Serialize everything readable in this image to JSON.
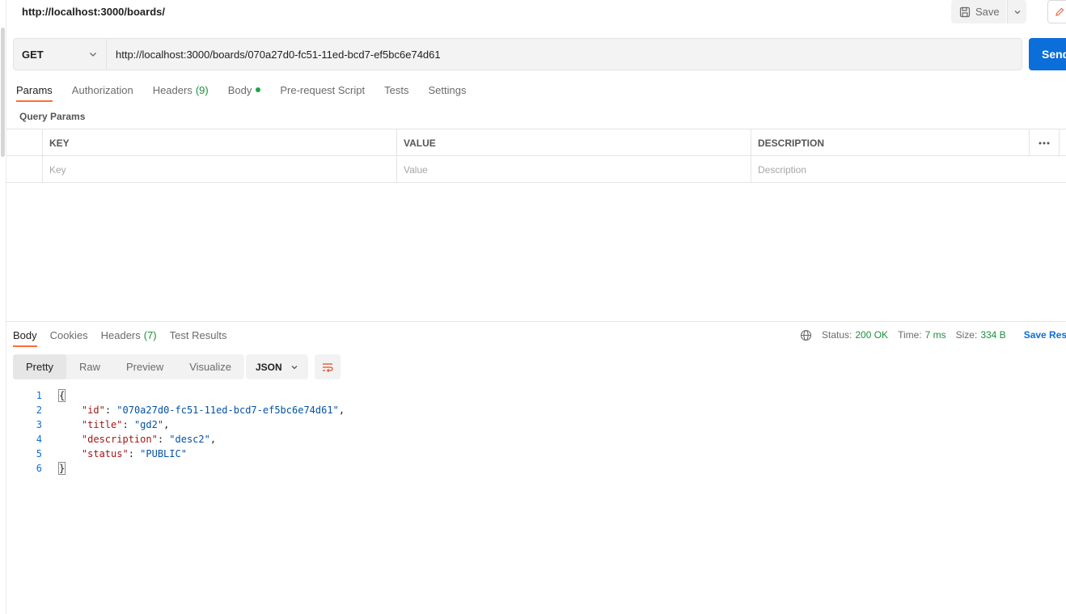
{
  "request": {
    "name": "http://localhost:3000/boards/",
    "save_label": "Save",
    "method": "GET",
    "url": "http://localhost:3000/boards/070a27d0-fc51-11ed-bcd7-ef5bc6e74d61",
    "send_label": "Send"
  },
  "request_tabs": [
    {
      "label": "Params",
      "active": true
    },
    {
      "label": "Authorization"
    },
    {
      "label": "Headers",
      "count": "(9)"
    },
    {
      "label": "Body",
      "dot": true
    },
    {
      "label": "Pre-request Script"
    },
    {
      "label": "Tests"
    },
    {
      "label": "Settings"
    }
  ],
  "query_params": {
    "label": "Query Params",
    "headers": [
      "KEY",
      "VALUE",
      "DESCRIPTION"
    ],
    "placeholders": [
      "Key",
      "Value",
      "Description"
    ]
  },
  "response_tabs": [
    {
      "label": "Body",
      "active": true
    },
    {
      "label": "Cookies"
    },
    {
      "label": "Headers",
      "count": "(7)"
    },
    {
      "label": "Test Results"
    }
  ],
  "response_meta": {
    "status_label": "Status:",
    "status_value": "200 OK",
    "time_label": "Time:",
    "time_value": "7 ms",
    "size_label": "Size:",
    "size_value": "334 B",
    "save_response_label": "Save Response"
  },
  "view_modes": [
    "Pretty",
    "Raw",
    "Preview",
    "Visualize"
  ],
  "format": "JSON",
  "code_lines": [
    {
      "n": "1"
    },
    {
      "n": "2",
      "key": "\"id\"",
      "value": "\"070a27d0-fc51-11ed-bcd7-ef5bc6e74d61\"",
      "comma": ","
    },
    {
      "n": "3",
      "key": "\"title\"",
      "value": "\"gd2\"",
      "comma": ","
    },
    {
      "n": "4",
      "key": "\"description\"",
      "value": "\"desc2\"",
      "comma": ","
    },
    {
      "n": "5",
      "key": "\"status\"",
      "value": "\"PUBLIC\"",
      "comma": ""
    },
    {
      "n": "6"
    }
  ],
  "colors": {
    "accent": "#ff6c37",
    "send": "#0c6ed8",
    "success": "#1e8f3e"
  }
}
